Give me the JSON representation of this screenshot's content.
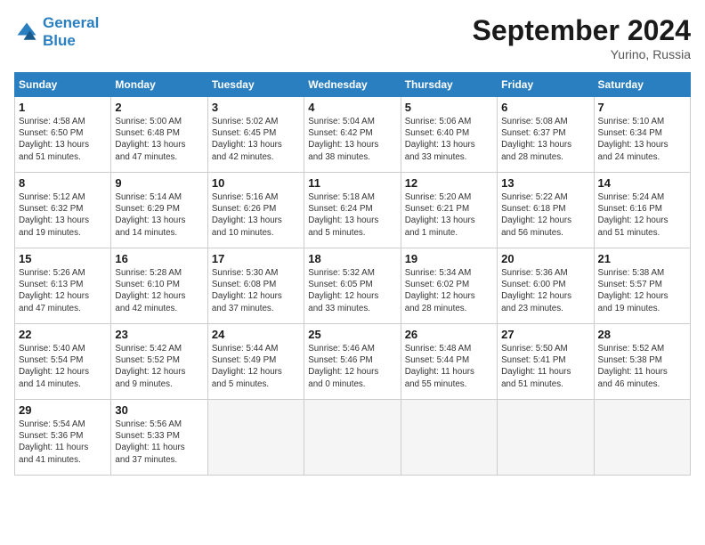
{
  "header": {
    "logo_line1": "General",
    "logo_line2": "Blue",
    "month_title": "September 2024",
    "location": "Yurino, Russia"
  },
  "columns": [
    "Sunday",
    "Monday",
    "Tuesday",
    "Wednesday",
    "Thursday",
    "Friday",
    "Saturday"
  ],
  "weeks": [
    [
      {
        "day": "1",
        "info": "Sunrise: 4:58 AM\nSunset: 6:50 PM\nDaylight: 13 hours\nand 51 minutes."
      },
      {
        "day": "2",
        "info": "Sunrise: 5:00 AM\nSunset: 6:48 PM\nDaylight: 13 hours\nand 47 minutes."
      },
      {
        "day": "3",
        "info": "Sunrise: 5:02 AM\nSunset: 6:45 PM\nDaylight: 13 hours\nand 42 minutes."
      },
      {
        "day": "4",
        "info": "Sunrise: 5:04 AM\nSunset: 6:42 PM\nDaylight: 13 hours\nand 38 minutes."
      },
      {
        "day": "5",
        "info": "Sunrise: 5:06 AM\nSunset: 6:40 PM\nDaylight: 13 hours\nand 33 minutes."
      },
      {
        "day": "6",
        "info": "Sunrise: 5:08 AM\nSunset: 6:37 PM\nDaylight: 13 hours\nand 28 minutes."
      },
      {
        "day": "7",
        "info": "Sunrise: 5:10 AM\nSunset: 6:34 PM\nDaylight: 13 hours\nand 24 minutes."
      }
    ],
    [
      {
        "day": "8",
        "info": "Sunrise: 5:12 AM\nSunset: 6:32 PM\nDaylight: 13 hours\nand 19 minutes."
      },
      {
        "day": "9",
        "info": "Sunrise: 5:14 AM\nSunset: 6:29 PM\nDaylight: 13 hours\nand 14 minutes."
      },
      {
        "day": "10",
        "info": "Sunrise: 5:16 AM\nSunset: 6:26 PM\nDaylight: 13 hours\nand 10 minutes."
      },
      {
        "day": "11",
        "info": "Sunrise: 5:18 AM\nSunset: 6:24 PM\nDaylight: 13 hours\nand 5 minutes."
      },
      {
        "day": "12",
        "info": "Sunrise: 5:20 AM\nSunset: 6:21 PM\nDaylight: 13 hours\nand 1 minute."
      },
      {
        "day": "13",
        "info": "Sunrise: 5:22 AM\nSunset: 6:18 PM\nDaylight: 12 hours\nand 56 minutes."
      },
      {
        "day": "14",
        "info": "Sunrise: 5:24 AM\nSunset: 6:16 PM\nDaylight: 12 hours\nand 51 minutes."
      }
    ],
    [
      {
        "day": "15",
        "info": "Sunrise: 5:26 AM\nSunset: 6:13 PM\nDaylight: 12 hours\nand 47 minutes."
      },
      {
        "day": "16",
        "info": "Sunrise: 5:28 AM\nSunset: 6:10 PM\nDaylight: 12 hours\nand 42 minutes."
      },
      {
        "day": "17",
        "info": "Sunrise: 5:30 AM\nSunset: 6:08 PM\nDaylight: 12 hours\nand 37 minutes."
      },
      {
        "day": "18",
        "info": "Sunrise: 5:32 AM\nSunset: 6:05 PM\nDaylight: 12 hours\nand 33 minutes."
      },
      {
        "day": "19",
        "info": "Sunrise: 5:34 AM\nSunset: 6:02 PM\nDaylight: 12 hours\nand 28 minutes."
      },
      {
        "day": "20",
        "info": "Sunrise: 5:36 AM\nSunset: 6:00 PM\nDaylight: 12 hours\nand 23 minutes."
      },
      {
        "day": "21",
        "info": "Sunrise: 5:38 AM\nSunset: 5:57 PM\nDaylight: 12 hours\nand 19 minutes."
      }
    ],
    [
      {
        "day": "22",
        "info": "Sunrise: 5:40 AM\nSunset: 5:54 PM\nDaylight: 12 hours\nand 14 minutes."
      },
      {
        "day": "23",
        "info": "Sunrise: 5:42 AM\nSunset: 5:52 PM\nDaylight: 12 hours\nand 9 minutes."
      },
      {
        "day": "24",
        "info": "Sunrise: 5:44 AM\nSunset: 5:49 PM\nDaylight: 12 hours\nand 5 minutes."
      },
      {
        "day": "25",
        "info": "Sunrise: 5:46 AM\nSunset: 5:46 PM\nDaylight: 12 hours\nand 0 minutes."
      },
      {
        "day": "26",
        "info": "Sunrise: 5:48 AM\nSunset: 5:44 PM\nDaylight: 11 hours\nand 55 minutes."
      },
      {
        "day": "27",
        "info": "Sunrise: 5:50 AM\nSunset: 5:41 PM\nDaylight: 11 hours\nand 51 minutes."
      },
      {
        "day": "28",
        "info": "Sunrise: 5:52 AM\nSunset: 5:38 PM\nDaylight: 11 hours\nand 46 minutes."
      }
    ],
    [
      {
        "day": "29",
        "info": "Sunrise: 5:54 AM\nSunset: 5:36 PM\nDaylight: 11 hours\nand 41 minutes."
      },
      {
        "day": "30",
        "info": "Sunrise: 5:56 AM\nSunset: 5:33 PM\nDaylight: 11 hours\nand 37 minutes."
      },
      {
        "day": "",
        "info": ""
      },
      {
        "day": "",
        "info": ""
      },
      {
        "day": "",
        "info": ""
      },
      {
        "day": "",
        "info": ""
      },
      {
        "day": "",
        "info": ""
      }
    ]
  ]
}
